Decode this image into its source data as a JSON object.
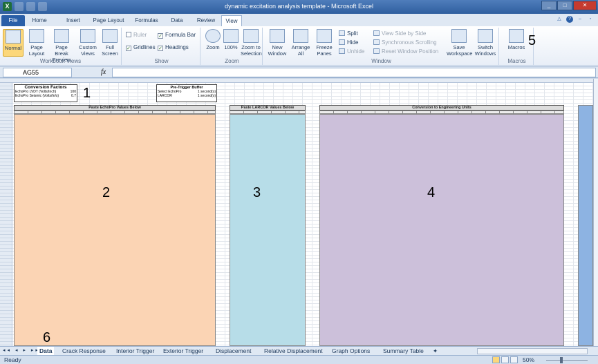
{
  "window": {
    "title": "dynamic excitation analysis template - Microsoft Excel",
    "app_icon_letter": "X"
  },
  "ribbon_tabs": [
    "File",
    "Home",
    "Insert",
    "Page Layout",
    "Formulas",
    "Data",
    "Review",
    "View"
  ],
  "active_tab": "View",
  "ribbon": {
    "workbook_views": {
      "label": "Workbook Views",
      "buttons": [
        "Normal",
        "Page Layout",
        "Page Break Preview",
        "Custom Views",
        "Full Screen"
      ]
    },
    "show": {
      "label": "Show",
      "ruler": "Ruler",
      "formula_bar": "Formula Bar",
      "gridlines": "Gridlines",
      "headings": "Headings"
    },
    "zoom": {
      "label": "Zoom",
      "buttons": [
        "Zoom",
        "100%",
        "Zoom to Selection"
      ]
    },
    "window": {
      "label": "Window",
      "buttons": [
        "New Window",
        "Arrange All",
        "Freeze Panes"
      ],
      "small": [
        "Split",
        "Hide",
        "Unhide",
        "View Side by Side",
        "Synchronous Scrolling",
        "Reset Window Position"
      ],
      "save_workspace": "Save Workspace",
      "switch_windows": "Switch Windows"
    },
    "macros": {
      "label": "Macros",
      "button": "Macros"
    }
  },
  "formula_bar": {
    "name_box": "AG55",
    "fx": "fx",
    "value": ""
  },
  "sheet": {
    "conversion_title": "Conversion Factors",
    "conversion_rows": [
      "EchoPro LVDT (Volts/Inch)",
      "EchoPro Seismic (Volts/In/s)"
    ],
    "conversion_values": [
      "100",
      "0.7"
    ],
    "pretrigger_title": "Pre-Trigger Buffer",
    "pretrigger_rows": [
      "Select EchoPro",
      "LARCOR"
    ],
    "pretrigger_values": [
      "1 second(s)",
      "1 second(s)"
    ],
    "header_orange": "Paste EchoPro Values Below",
    "header_blue": "Paste LARCOR Values Below",
    "header_purple": "Conversion to Engineering Units"
  },
  "callouts": [
    "1",
    "2",
    "3",
    "4",
    "5",
    "6"
  ],
  "sheet_tabs": [
    "Data",
    "Crack Response",
    "Interior Trigger",
    "Exterior Trigger",
    "Displacement",
    "Relative Displacement",
    "Graph Options",
    "Summary Table"
  ],
  "active_sheet": "Data",
  "status": {
    "ready": "Ready",
    "zoom": "50%"
  },
  "colors": {
    "orange": "#fbd4b4",
    "blue": "#b7dde8",
    "purple": "#ccc0da",
    "far": "#8db3e2"
  }
}
